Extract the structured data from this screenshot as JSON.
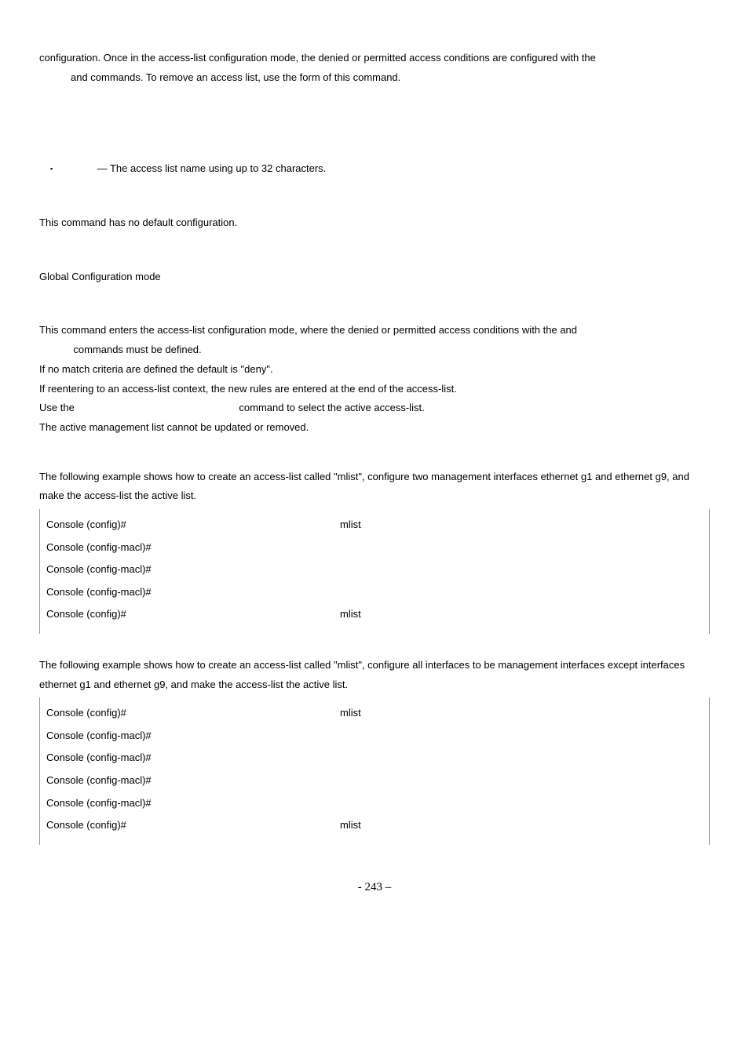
{
  "intro_sentence": "configuration. Once in the access-list configuration mode, the denied or permitted access conditions are configured with the",
  "intro_cont": " and             commands. To remove an access list, use the       form of this command.",
  "param_line": " — The access list name using up to 32 characters.",
  "default_line": "This command has no default configuration.",
  "mode_line": "Global Configuration mode",
  "guide_line1a": "This command enters the access-list configuration mode, where the denied or permitted access conditions with the         and",
  "guide_line1b": "            commands must be defined.",
  "guide_line2": "If no match criteria are defined the default is \"deny\".",
  "guide_line3": "If reentering to an access-list context, the new rules are entered at the end of the access-list.",
  "guide_line4a": "Use the ",
  "guide_line4b": "command to select the active access-list.",
  "guide_line5": "The active management list cannot be updated or removed.",
  "example1_caption": "The following example shows how to create an access-list called \"mlist\", configure two management interfaces ethernet g1 and ethernet g9, and make the access-list the active list.",
  "example1": {
    "r0_prompt": "Console (config)# ",
    "r0_arg": "mlist",
    "r1_prompt": "Console (config-macl)# ",
    "r2_prompt": "Console (config-macl)# ",
    "r3_prompt": "Console (config-macl)# ",
    "r4_prompt": "Console (config)# ",
    "r4_arg": "mlist"
  },
  "example2_caption": "The following example shows how to create an access-list called \"mlist\", configure all interfaces to be management interfaces except interfaces ethernet g1 and ethernet g9, and make the access-list the active list.",
  "example2": {
    "r0_prompt": "Console (config)# ",
    "r0_arg": "mlist",
    "r1_prompt": "Console (config-macl)# ",
    "r2_prompt": "Console (config-macl)# ",
    "r3_prompt": "Console (config-macl)# ",
    "r4_prompt": "Console (config-macl)# ",
    "r5_prompt": "Console (config)# ",
    "r5_arg": "mlist"
  },
  "page_number": "- 243 –"
}
